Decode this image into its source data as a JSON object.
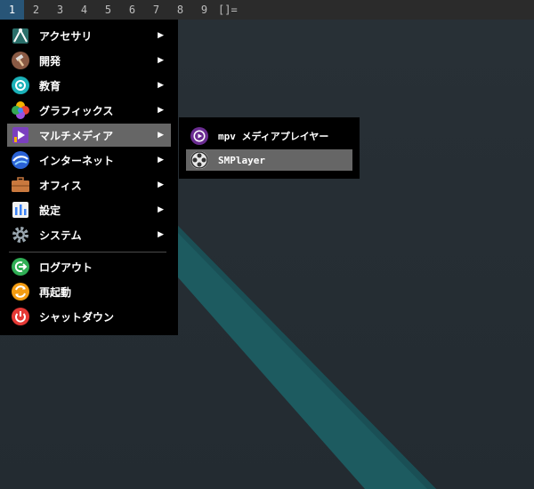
{
  "topbar": {
    "workspaces": [
      "1",
      "2",
      "3",
      "4",
      "5",
      "6",
      "7",
      "8",
      "9"
    ],
    "active_workspace": "1",
    "layout_indicator": "[]="
  },
  "menu": {
    "items": [
      {
        "label": "アクセサリ",
        "icon": "accessories-icon",
        "submenu": true
      },
      {
        "label": "開発",
        "icon": "development-icon",
        "submenu": true
      },
      {
        "label": "教育",
        "icon": "education-icon",
        "submenu": true
      },
      {
        "label": "グラフィックス",
        "icon": "graphics-icon",
        "submenu": true
      },
      {
        "label": "マルチメディア",
        "icon": "multimedia-icon",
        "submenu": true,
        "highlighted": true
      },
      {
        "label": "インターネット",
        "icon": "internet-icon",
        "submenu": true
      },
      {
        "label": "オフィス",
        "icon": "office-icon",
        "submenu": true
      },
      {
        "label": "設定",
        "icon": "settings-icon",
        "submenu": true
      },
      {
        "label": "システム",
        "icon": "system-icon",
        "submenu": true
      },
      {
        "label": "ログアウト",
        "icon": "logout-icon",
        "submenu": false
      },
      {
        "label": "再起動",
        "icon": "reboot-icon",
        "submenu": false
      },
      {
        "label": "シャットダウン",
        "icon": "shutdown-icon",
        "submenu": false
      }
    ],
    "arrow": "▶"
  },
  "submenu": {
    "items": [
      {
        "label": "mpv メディアプレイヤー",
        "icon": "mpv-icon"
      },
      {
        "label": "SMPlayer",
        "icon": "smplayer-icon",
        "highlighted": true
      }
    ]
  },
  "colors": {
    "desktop": "#252d33",
    "stripe": "#1d5b60",
    "menu_bg": "#000000",
    "highlight": "#666666",
    "active_workspace": "#285577"
  }
}
